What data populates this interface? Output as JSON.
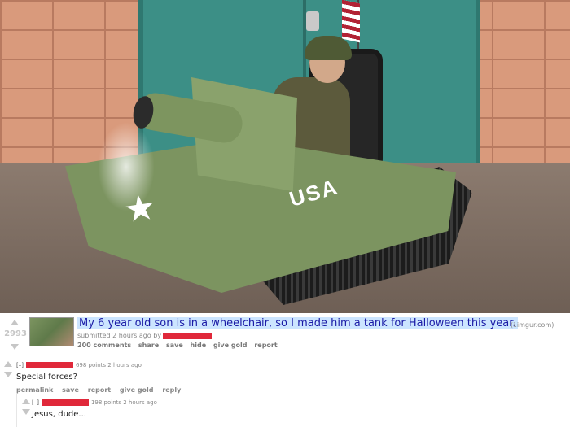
{
  "photo": {
    "tank_marking": "USA",
    "star_glyph": "★",
    "colors": {
      "tank": "#7c9460",
      "door": "#3c8f86",
      "brick": "#d99a7c"
    }
  },
  "post": {
    "score": "2993",
    "title": "My 6 year old son is in a wheelchair, so I made him a tank for Halloween this year.",
    "domain": "(i.imgur.com)",
    "submitted": "submitted 2 hours ago by",
    "buttons": [
      "200 comments",
      "share",
      "save",
      "hide",
      "give gold",
      "report"
    ]
  },
  "comments": [
    {
      "toggle": "[–]",
      "meta": "698 points 2 hours ago",
      "body": "Special forces?",
      "buttons": [
        "permalink",
        "save",
        "report",
        "give gold",
        "reply"
      ]
    },
    {
      "toggle": "[–]",
      "meta": "198 points 2 hours ago",
      "body": "Jesus, dude..."
    }
  ],
  "colors": {
    "title_link": "#1a1aa6",
    "title_highlight": "#cce5ff",
    "redaction": "#e0283a",
    "vote_arrow": "#c6c6c6"
  },
  "icons": {
    "upvote": "upvote-arrow-icon",
    "downvote": "downvote-arrow-icon"
  }
}
